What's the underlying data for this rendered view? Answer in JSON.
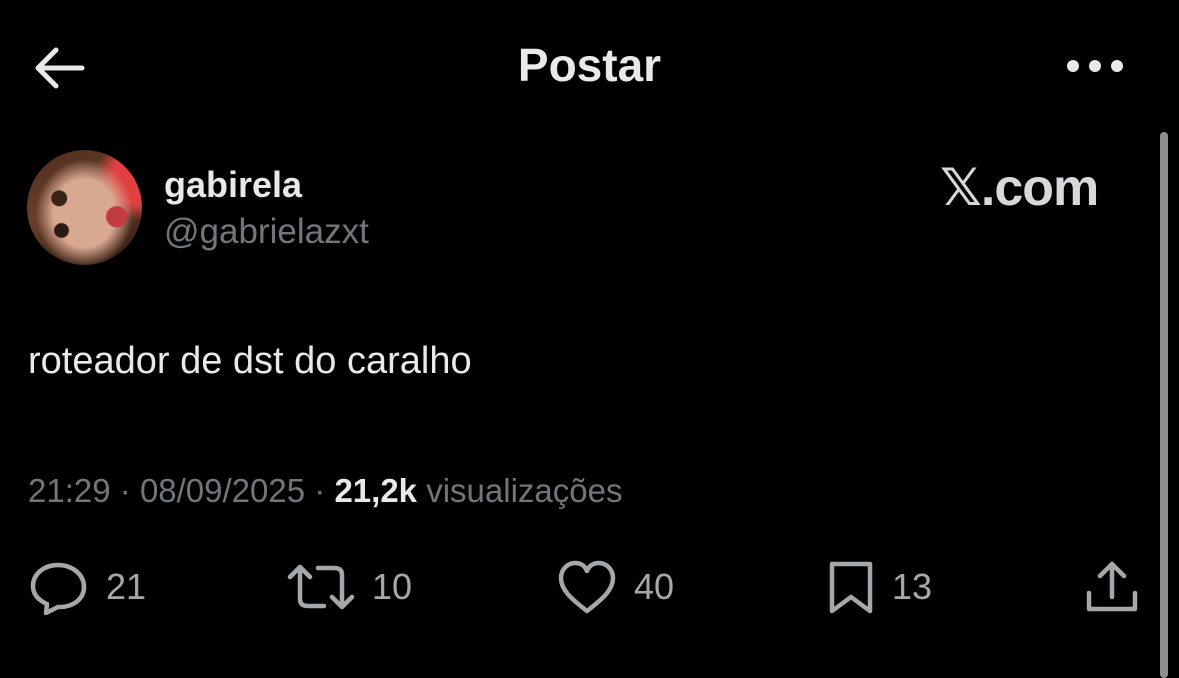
{
  "header": {
    "title": "Postar",
    "back_icon": "arrow-left-icon",
    "more_icon": "more-horizontal-icon"
  },
  "post": {
    "author": {
      "display_name": "gabirela",
      "handle": "@gabrielazxt"
    },
    "watermark": "𝕏.com",
    "text": "roteador de dst do caralho",
    "time": "21:29",
    "separator": "·",
    "date": "08/09/2025",
    "views_count": "21,2k",
    "views_label": "visualizações",
    "stats": {
      "replies": "21",
      "reposts": "10",
      "likes": "40",
      "bookmarks": "13"
    }
  },
  "colors": {
    "background": "#000000",
    "primary_text": "#e7e9ea",
    "secondary_text": "#71767b",
    "icon": "#a4a8ab"
  }
}
